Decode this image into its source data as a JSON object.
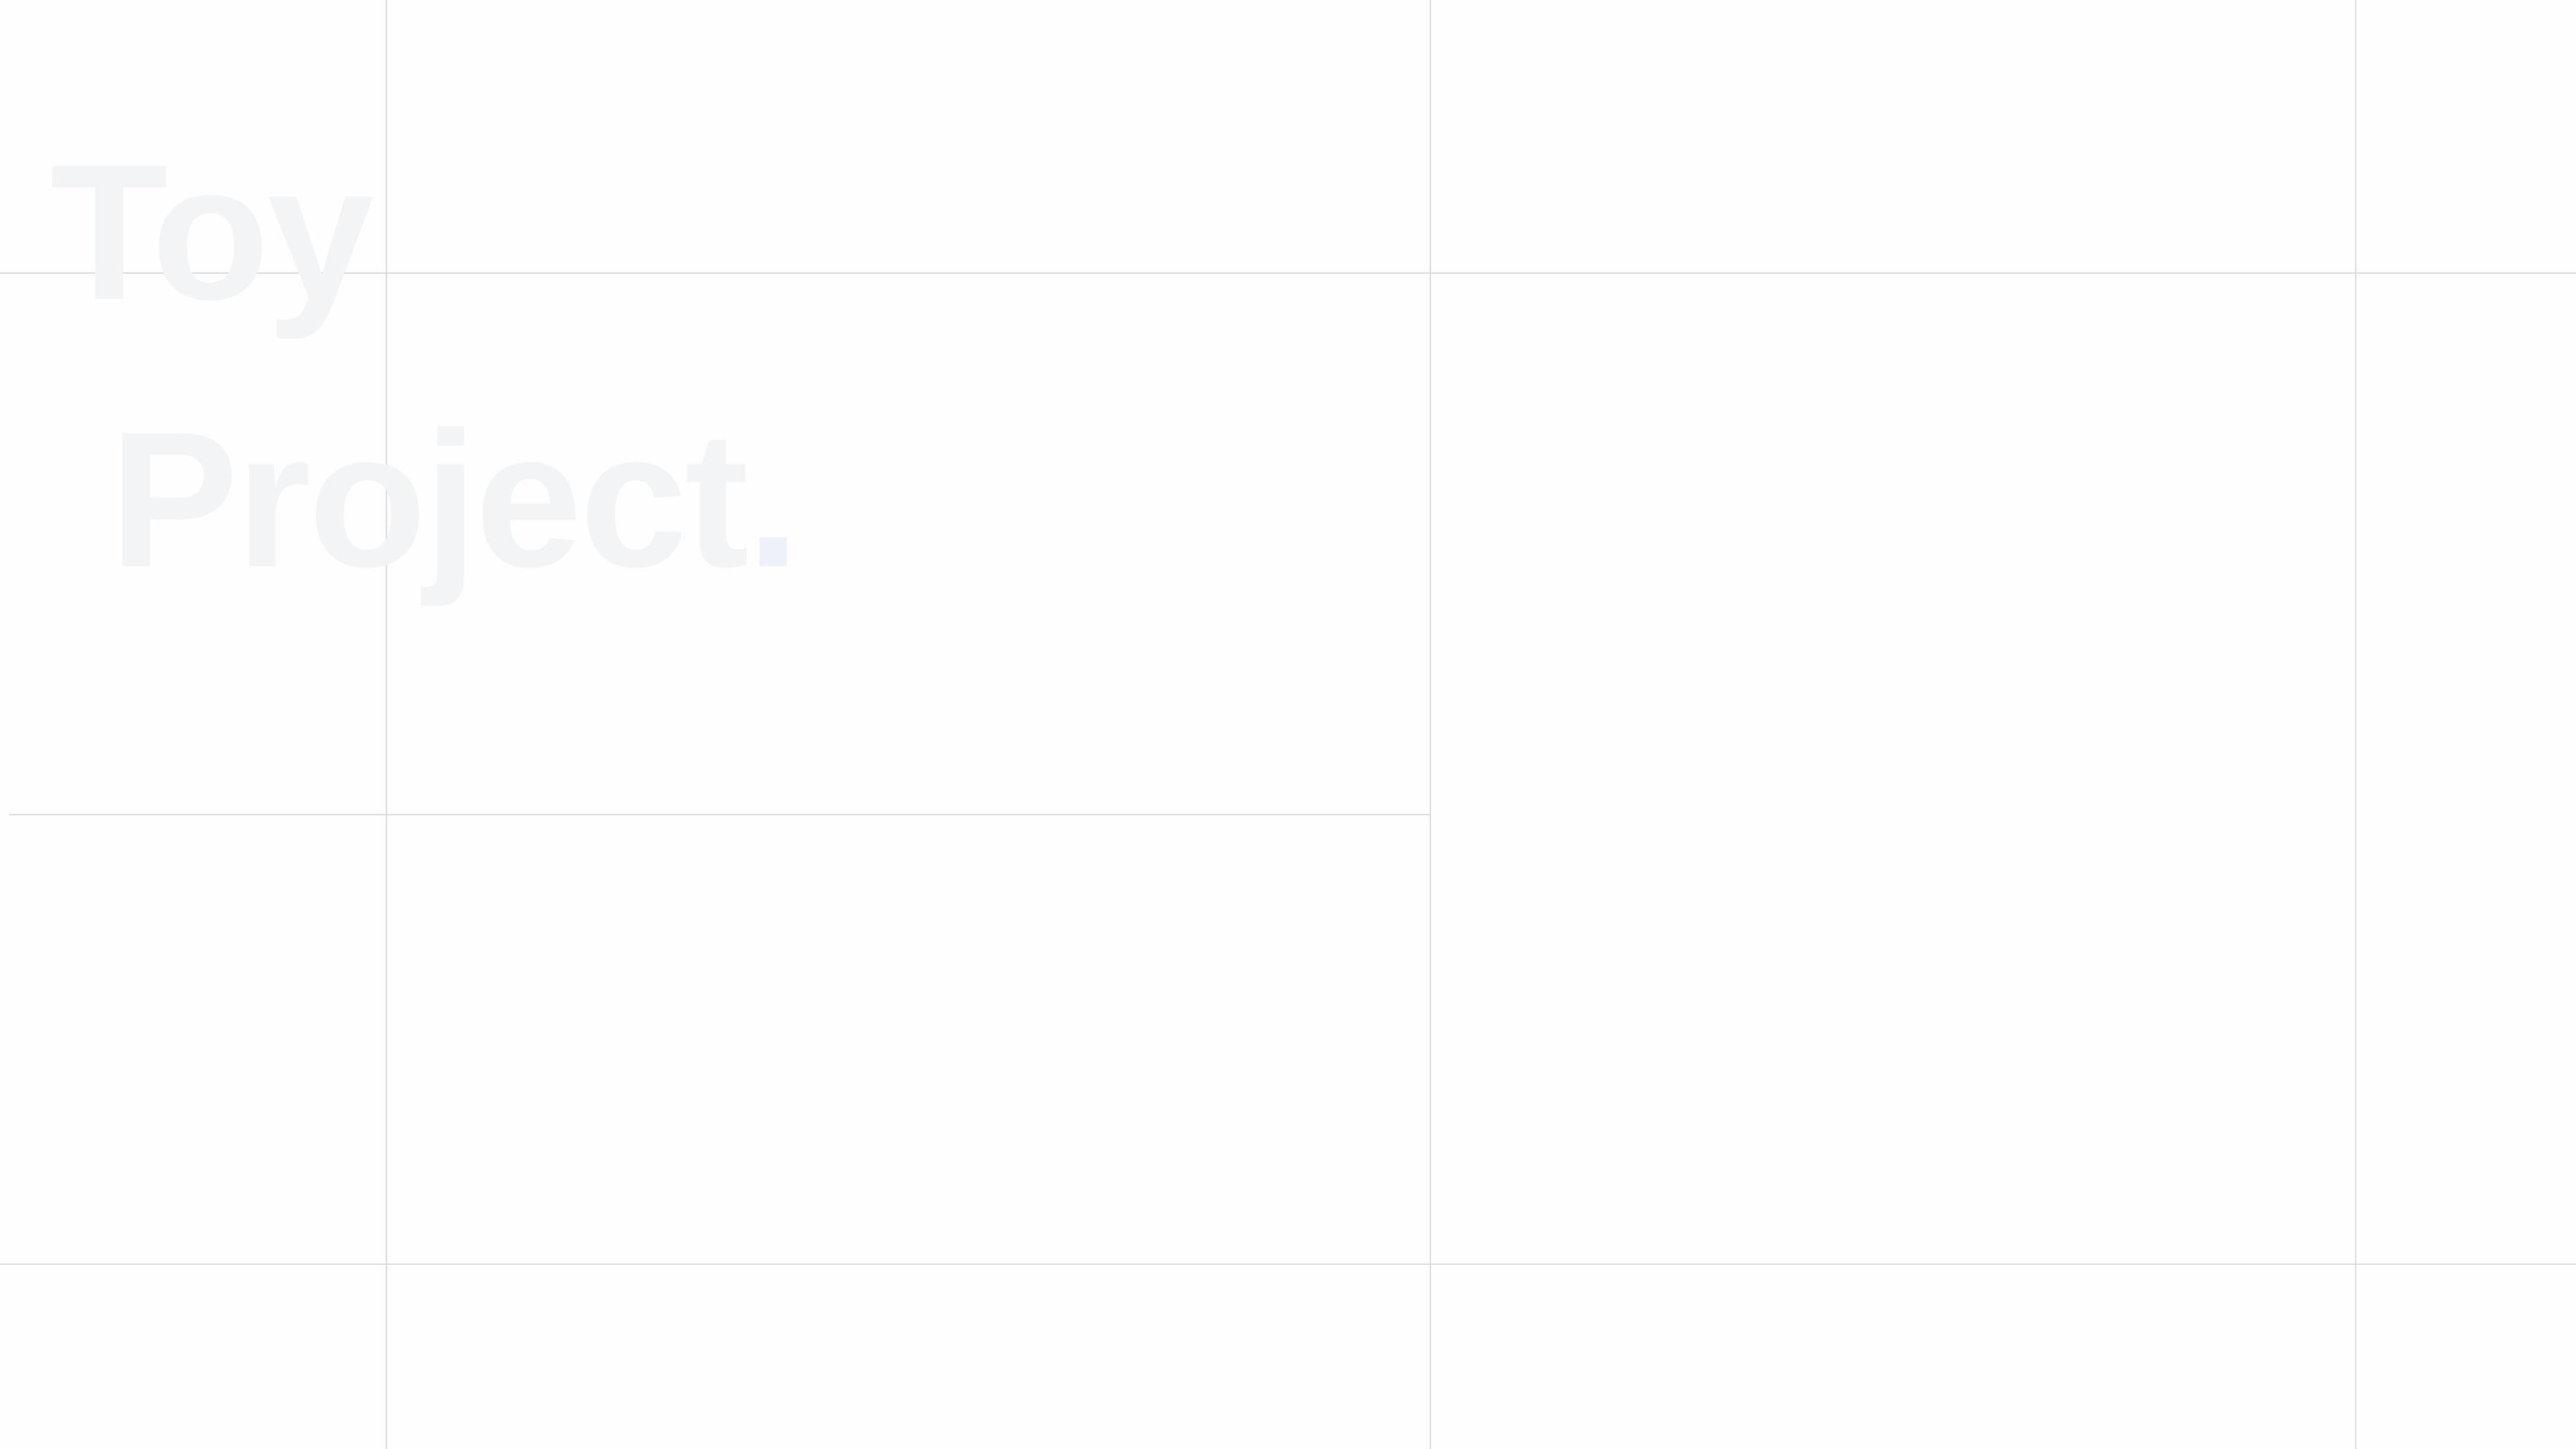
{
  "hero": {
    "line1": "Toy",
    "line2": "Project",
    "dot": "."
  },
  "colors": {
    "background": "#fefefe",
    "title_text": "#f3f4f6",
    "title_dot": "#eef2f8",
    "grid_line": "#d6d9dd"
  }
}
